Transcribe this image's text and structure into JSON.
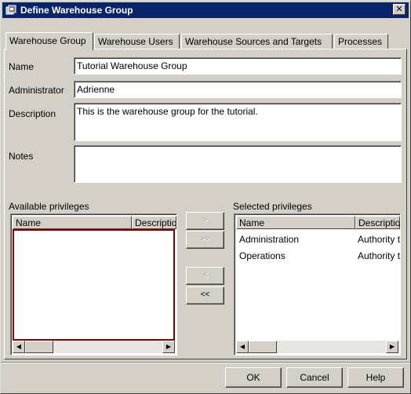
{
  "window": {
    "title": "Define Warehouse Group",
    "close_label": "✕"
  },
  "tabs": [
    {
      "label": "Warehouse Group",
      "active": true
    },
    {
      "label": "Warehouse Users",
      "active": false
    },
    {
      "label": "Warehouse Sources and Targets",
      "active": false
    },
    {
      "label": "Processes",
      "active": false
    }
  ],
  "form": {
    "name_label": "Name",
    "name_value": "Tutorial Warehouse Group",
    "administrator_label": "Administrator",
    "administrator_value": "Adrienne",
    "description_label": "Description",
    "description_value": "This is the warehouse group for the tutorial.",
    "notes_label": "Notes",
    "notes_value": ""
  },
  "available_privileges": {
    "label": "Available privileges",
    "columns": [
      "Name",
      "Description"
    ],
    "rows": []
  },
  "selected_privileges": {
    "label": "Selected privileges",
    "columns": [
      "Name",
      "Description"
    ],
    "rows": [
      {
        "name": "Administration",
        "description": "Authority to define and manage warehouse objects"
      },
      {
        "name": "Operations",
        "description": "Authority to run processes"
      }
    ]
  },
  "transfer_buttons": {
    "add": ">",
    "add_all": ">>",
    "remove": "<",
    "remove_all": "<<"
  },
  "dialog_buttons": {
    "ok": "OK",
    "cancel": "Cancel",
    "help": "Help"
  },
  "scroll_icons": {
    "left": "◀",
    "right": "▶"
  }
}
